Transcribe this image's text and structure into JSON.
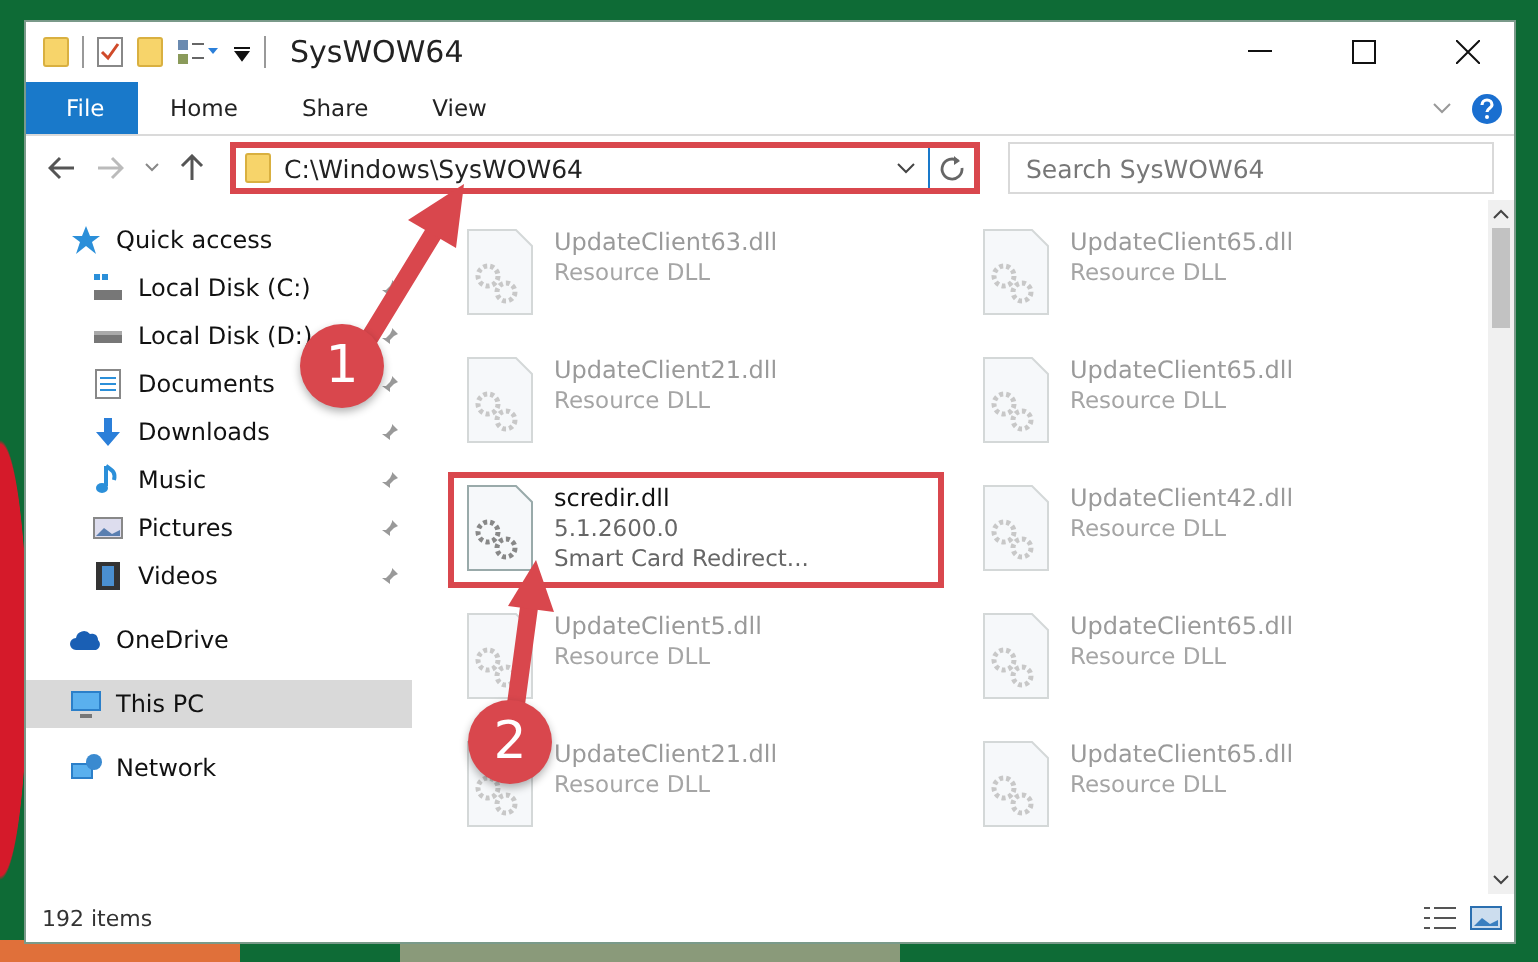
{
  "window": {
    "title": "SysWOW64"
  },
  "ribbon": {
    "tabs": [
      {
        "label": "File",
        "kind": "file",
        "selected": false
      },
      {
        "label": "Home",
        "kind": "tab",
        "selected": false
      },
      {
        "label": "Share",
        "kind": "tab",
        "selected": false
      },
      {
        "label": "View",
        "kind": "tab",
        "selected": false
      }
    ]
  },
  "address": {
    "path": "C:\\Windows\\SysWOW64",
    "highlighted": true
  },
  "search": {
    "placeholder": "Search SysWOW64"
  },
  "sidebar": {
    "items": [
      {
        "label": "Quick access",
        "kind": "star",
        "selected": false,
        "children": [
          {
            "label": "Local Disk (C:)",
            "kind": "drive-c",
            "pinned": true,
            "selected": false
          },
          {
            "label": "Local Disk (D:)",
            "kind": "drive",
            "pinned": true,
            "selected": false
          },
          {
            "label": "Documents",
            "kind": "documents",
            "pinned": true,
            "selected": false
          },
          {
            "label": "Downloads",
            "kind": "downloads",
            "pinned": true,
            "selected": false
          },
          {
            "label": "Music",
            "kind": "music",
            "pinned": true,
            "selected": false
          },
          {
            "label": "Pictures",
            "kind": "pictures",
            "pinned": true,
            "selected": false
          },
          {
            "label": "Videos",
            "kind": "videos",
            "pinned": true,
            "selected": false
          }
        ]
      },
      {
        "label": "OneDrive",
        "kind": "cloud",
        "selected": false
      },
      {
        "label": "This PC",
        "kind": "pc",
        "selected": true
      },
      {
        "label": "Network",
        "kind": "network",
        "selected": false
      }
    ]
  },
  "files": [
    {
      "name": "UpdateClient63.dll",
      "lines": [
        "Resource DLL"
      ],
      "faded": true,
      "highlighted": false
    },
    {
      "name": "UpdateClient65.dll",
      "lines": [
        "Resource DLL"
      ],
      "faded": true,
      "highlighted": false
    },
    {
      "name": "UpdateClient21.dll",
      "lines": [
        "Resource DLL"
      ],
      "faded": true,
      "highlighted": false
    },
    {
      "name": "UpdateClient65.dll",
      "lines": [
        "Resource DLL"
      ],
      "faded": true,
      "highlighted": false
    },
    {
      "name": "scredir.dll",
      "lines": [
        "5.1.2600.0",
        "Smart Card Redirect..."
      ],
      "faded": false,
      "highlighted": true
    },
    {
      "name": "UpdateClient42.dll",
      "lines": [
        "Resource DLL"
      ],
      "faded": true,
      "highlighted": false
    },
    {
      "name": "UpdateClient5.dll",
      "lines": [
        "Resource DLL"
      ],
      "faded": true,
      "highlighted": false
    },
    {
      "name": "UpdateClient65.dll",
      "lines": [
        "Resource DLL"
      ],
      "faded": true,
      "highlighted": false
    },
    {
      "name": "UpdateClient21.dll",
      "lines": [
        "Resource DLL"
      ],
      "faded": true,
      "highlighted": false
    },
    {
      "name": "UpdateClient65.dll",
      "lines": [
        "Resource DLL"
      ],
      "faded": true,
      "highlighted": false
    }
  ],
  "status_bar": {
    "count": "192 items"
  },
  "annotations": [
    {
      "label": "1"
    },
    {
      "label": "2"
    }
  ]
}
